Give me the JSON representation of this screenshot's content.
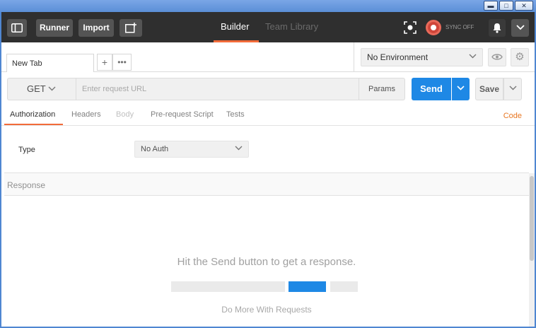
{
  "window": {
    "minimize": "▬",
    "maximize": "□",
    "close": "✕"
  },
  "header": {
    "sidebar_toggle_icon": "sidebar-toggle-icon",
    "runner_label": "Runner",
    "import_label": "Import",
    "new_window_icon": "new-window-icon",
    "tabs": [
      {
        "label": "Builder",
        "active": true
      },
      {
        "label": "Team Library",
        "active": false
      }
    ],
    "capture_icon": "capture-icon",
    "sync_label": "SYNC OFF",
    "sync_color": "#d0463a",
    "notifications_icon": "bell-icon",
    "menu_icon": "chevron-down-icon"
  },
  "tabs": {
    "open_tab_label": "New Tab",
    "add_symbol": "+",
    "more_symbol": "•••"
  },
  "environment": {
    "selected": "No Environment",
    "eye_icon": "eye-icon",
    "settings_icon": "gear-icon"
  },
  "request": {
    "method": "GET",
    "url_placeholder": "Enter request URL",
    "params_label": "Params",
    "send_label": "Send",
    "save_label": "Save",
    "send_color": "#1e88e5"
  },
  "sub_tabs": [
    {
      "label": "Authorization",
      "state": "active"
    },
    {
      "label": "Headers",
      "state": "normal"
    },
    {
      "label": "Body",
      "state": "disabled"
    },
    {
      "label": "Pre-request Script",
      "state": "normal"
    },
    {
      "label": "Tests",
      "state": "normal"
    }
  ],
  "code_link": "Code",
  "auth": {
    "type_label": "Type",
    "selected": "No Auth"
  },
  "response": {
    "label": "Response",
    "hint": "Hit the Send button to get a response.",
    "do_more": "Do More With Requests"
  },
  "accent_color": "#f26b3a"
}
